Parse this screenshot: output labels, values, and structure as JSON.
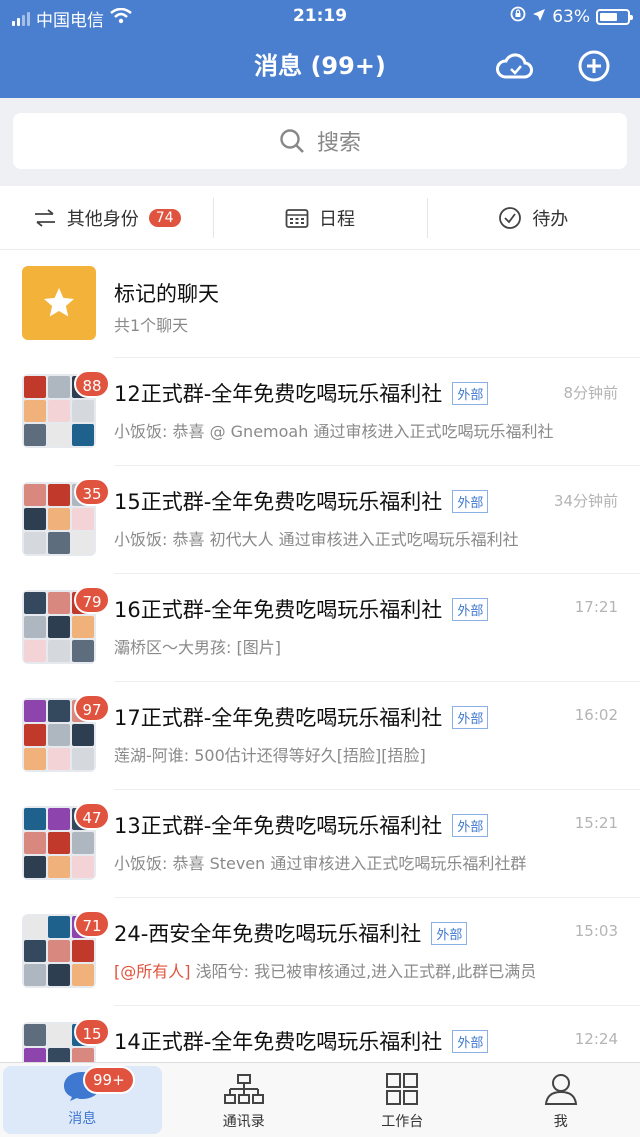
{
  "status_bar": {
    "carrier": "中国电信",
    "time": "21:19",
    "battery_percent": "63%"
  },
  "nav": {
    "title": "消息 (99+)"
  },
  "search": {
    "placeholder": "搜索"
  },
  "quick_actions": {
    "identity_label": "其他身份",
    "identity_badge": "74",
    "schedule_label": "日程",
    "todo_label": "待办"
  },
  "starred": {
    "title": "标记的聊天",
    "subtitle": "共1个聊天"
  },
  "chats": [
    {
      "title": "12正式群-全年免费吃喝玩乐福利社",
      "tag": "外部",
      "time": "8分钟前",
      "badge": "88",
      "preview": "小饭饭: 恭喜 @ Gnemoah 通过审核进入正式吃喝玩乐福利社",
      "mention": ""
    },
    {
      "title": "15正式群-全年免费吃喝玩乐福利社",
      "tag": "外部",
      "time": "34分钟前",
      "badge": "35",
      "preview": "小饭饭: 恭喜 初代大人 通过审核进入正式吃喝玩乐福利社",
      "mention": ""
    },
    {
      "title": "16正式群-全年免费吃喝玩乐福利社",
      "tag": "外部",
      "time": "17:21",
      "badge": "79",
      "preview": "灞桥区～大男孩: [图片]",
      "mention": ""
    },
    {
      "title": "17正式群-全年免费吃喝玩乐福利社",
      "tag": "外部",
      "time": "16:02",
      "badge": "97",
      "preview": "莲湖-阿谁: 500估计还得等好久[捂脸][捂脸]",
      "mention": ""
    },
    {
      "title": "13正式群-全年免费吃喝玩乐福利社",
      "tag": "外部",
      "time": "15:21",
      "badge": "47",
      "preview": "小饭饭: 恭喜 Steven 通过审核进入正式吃喝玩乐福利社群",
      "mention": ""
    },
    {
      "title": "24-西安全年免费吃喝玩乐福利社",
      "tag": "外部",
      "time": "15:03",
      "badge": "71",
      "preview": "浅陌兮: 我已被审核通过,进入正式群,此群已满员",
      "mention": "[@所有人]"
    },
    {
      "title": "14正式群-全年免费吃喝玩乐福利社",
      "tag": "外部",
      "time": "12:24",
      "badge": "15",
      "preview": "",
      "mention": ""
    }
  ],
  "tabbar": {
    "messages_label": "消息",
    "messages_badge": "99+",
    "contacts_label": "通讯录",
    "workbench_label": "工作台",
    "me_label": "我"
  },
  "colors": {
    "header": "#4a7ecf",
    "badge": "#e0533e",
    "star_tile": "#f3b23a",
    "tag": "#3e78d0"
  }
}
